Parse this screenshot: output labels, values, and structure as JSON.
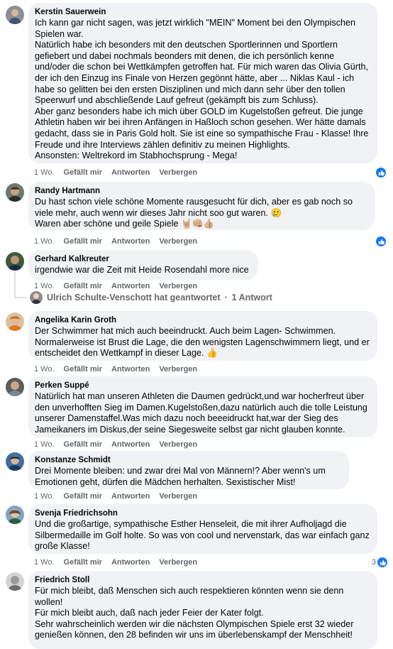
{
  "labels": {
    "time": "1 Wo.",
    "like": "Gefällt mir",
    "reply": "Antworten",
    "hide": "Verbergen"
  },
  "comments": [
    {
      "author": "Kerstin Sauerwein",
      "text": "Ich kann gar nicht sagen, was jetzt wirklich \"MEIN\" Moment bei den Olympischen Spielen war.\nNatürlich habe ich besonders mit den deutschen Sportlerinnen und Sportlern gefiebert und dabei nochmals beonders mit denen, die ich persönlich kenne und/oder die schon bei Wettkämpfen getroffen hat. Für mich waren das Olivia Gürth, der ich den Einzug ins Finale von Herzen gegönnt hätte, aber ... Niklas Kaul - ich habe so gelitten bei den ersten Disziplinen und mich dann sehr über den tollen Speerwurf und abschließende Lauf gefreut (gekämpft bis zum Schluss).\nAber ganz besonders habe ich mich über GOLD im Kugelstoßen gefreut. Die junge Athletin haben wir bei ihren Anfängen in Haßloch schon gesehen. Wer hätte damals gedacht, dass sie in Paris Gold holt. Sie ist eine so sympathische Frau - Klasse! Ihre Freude und ihre Interviews zählen definitiv zu meinen Highlights.\nAnsonsten: Weltrekord im Stabhochsprung - Mega!"
    },
    {
      "author": "Randy Hartmann",
      "text": "Du hast schon viele schöne Momente rausgesucht für dich, aber es gab noch so viele mehr, auch wenn wir dieses Jahr nicht soo gut waren. 🥲\nWaren aber schöne und geile Spiele 🤘🏼👊🏼👍🏼"
    },
    {
      "author": "Gerhard Kalkreuter",
      "text": "irgendwie war die Zeit mit Heide Rosendahl more nice"
    },
    {
      "author": "Angelika Karin Groth",
      "text": "Der Schwimmer hat mich auch beeindruckt. Auch beim Lagen- Schwimmen. Normalerweise ist Brust die Lage, die den wenigsten Lagenschwimmern liegt, und er entscheidet den Wettkampf in dieser Lage. 👍"
    },
    {
      "author": "Perken Suppé",
      "text": "Natürlich hat man unseren Athleten die Daumen gedrückt,und war hocherfreut über den unverhofften Sieg im Damen.Kugelstoßen,dazu natürlich auch die tolle Leistung unserer Damenstaffel.Was mich dazu noch beeeidruckt hat,war der Sieg des Jameikaners im Diskus,der seine Siegesweite selbst gar nicht glauben konnte."
    },
    {
      "author": "Konstanze Schmidt",
      "text": "Drei Momente bleiben: und zwar drei Mal von Männern!? Aber wenn's um Emotionen geht, dürfen die Mädchen herhalten. Sexistischer Mist!"
    },
    {
      "author": "Svenja Friedrichsohn",
      "text": "Und die großartige, sympathische Esther Henseleit, die mit ihrer Aufholjagd die Silbermedaille im Golf holte. So was von cool und nervenstark, das war einfach ganz große Klasse!"
    },
    {
      "author": "Friedrich Stoll",
      "text": "Für mich bleibt, daß Menschen sich auch respektieren könnten wenn sie denn wollen!\nFür mich bleibt auch, daß nach jeder Feier der Kater folgt.\nSehr wahrscheinlich werden wir die nächsten Olympischen Spiele erst 32 wieder genießen können, den 28 befinden wir uns im überlebenskampf der Menschheit!"
    }
  ],
  "reply_summary": {
    "name": "Ulrich Schulte-Venschott hat geantwortet",
    "separator": "·",
    "count": "1 Antwort"
  },
  "reaction_count_svenja": "3",
  "colors": {
    "bubble": "#f0f2f5",
    "like_blue": "#1877f2",
    "secondary_text": "#65676b"
  }
}
